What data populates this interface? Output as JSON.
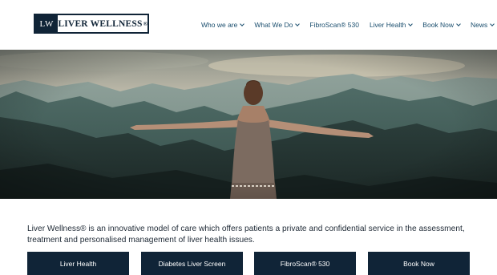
{
  "brand": {
    "mark": "LW",
    "name": "LIVER WELLNESS",
    "registered": "®"
  },
  "nav": {
    "items": [
      {
        "label": "Who we are"
      },
      {
        "label": "What We Do"
      },
      {
        "label": "FibroScan® 530"
      },
      {
        "label": "Liver Health"
      },
      {
        "label": "Book Now"
      },
      {
        "label": "News"
      }
    ]
  },
  "hero": {
    "image": "woman-arms-outstretched-mountains"
  },
  "intro": {
    "text": "Liver Wellness® is an innovative model of care which offers patients a private and confidential service in the assessment, treatment and personalised management of liver health issues."
  },
  "actions": [
    {
      "label": "Liver Health"
    },
    {
      "label": "Diabetes Liver Screen"
    },
    {
      "label": "FibroScan® 530"
    },
    {
      "label": "Book Now"
    }
  ],
  "colors": {
    "navy": "#102437",
    "nav_text": "#1a4e6e",
    "body_text": "#1f2a36"
  }
}
